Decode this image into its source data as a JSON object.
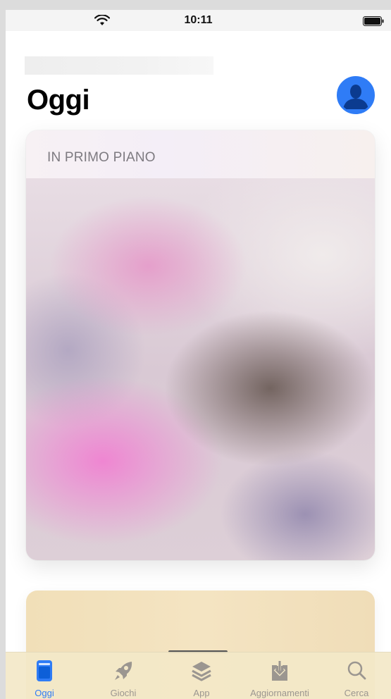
{
  "status_bar": {
    "time": "10:11"
  },
  "header": {
    "title": "Oggi"
  },
  "featured_card": {
    "label": "IN PRIMO PIANO"
  },
  "tabs": [
    {
      "label": "Oggi",
      "icon": "today-icon",
      "active": true
    },
    {
      "label": "Giochi",
      "icon": "rocket-icon",
      "active": false
    },
    {
      "label": "App",
      "icon": "layers-icon",
      "active": false
    },
    {
      "label": "Aggiornamenti",
      "icon": "download-icon",
      "active": false
    },
    {
      "label": "Cerca",
      "icon": "search-icon",
      "active": false
    }
  ],
  "colors": {
    "accent": "#2f7cf6",
    "inactive": "#9b9690",
    "tab_bar": "#f3e8c8"
  }
}
